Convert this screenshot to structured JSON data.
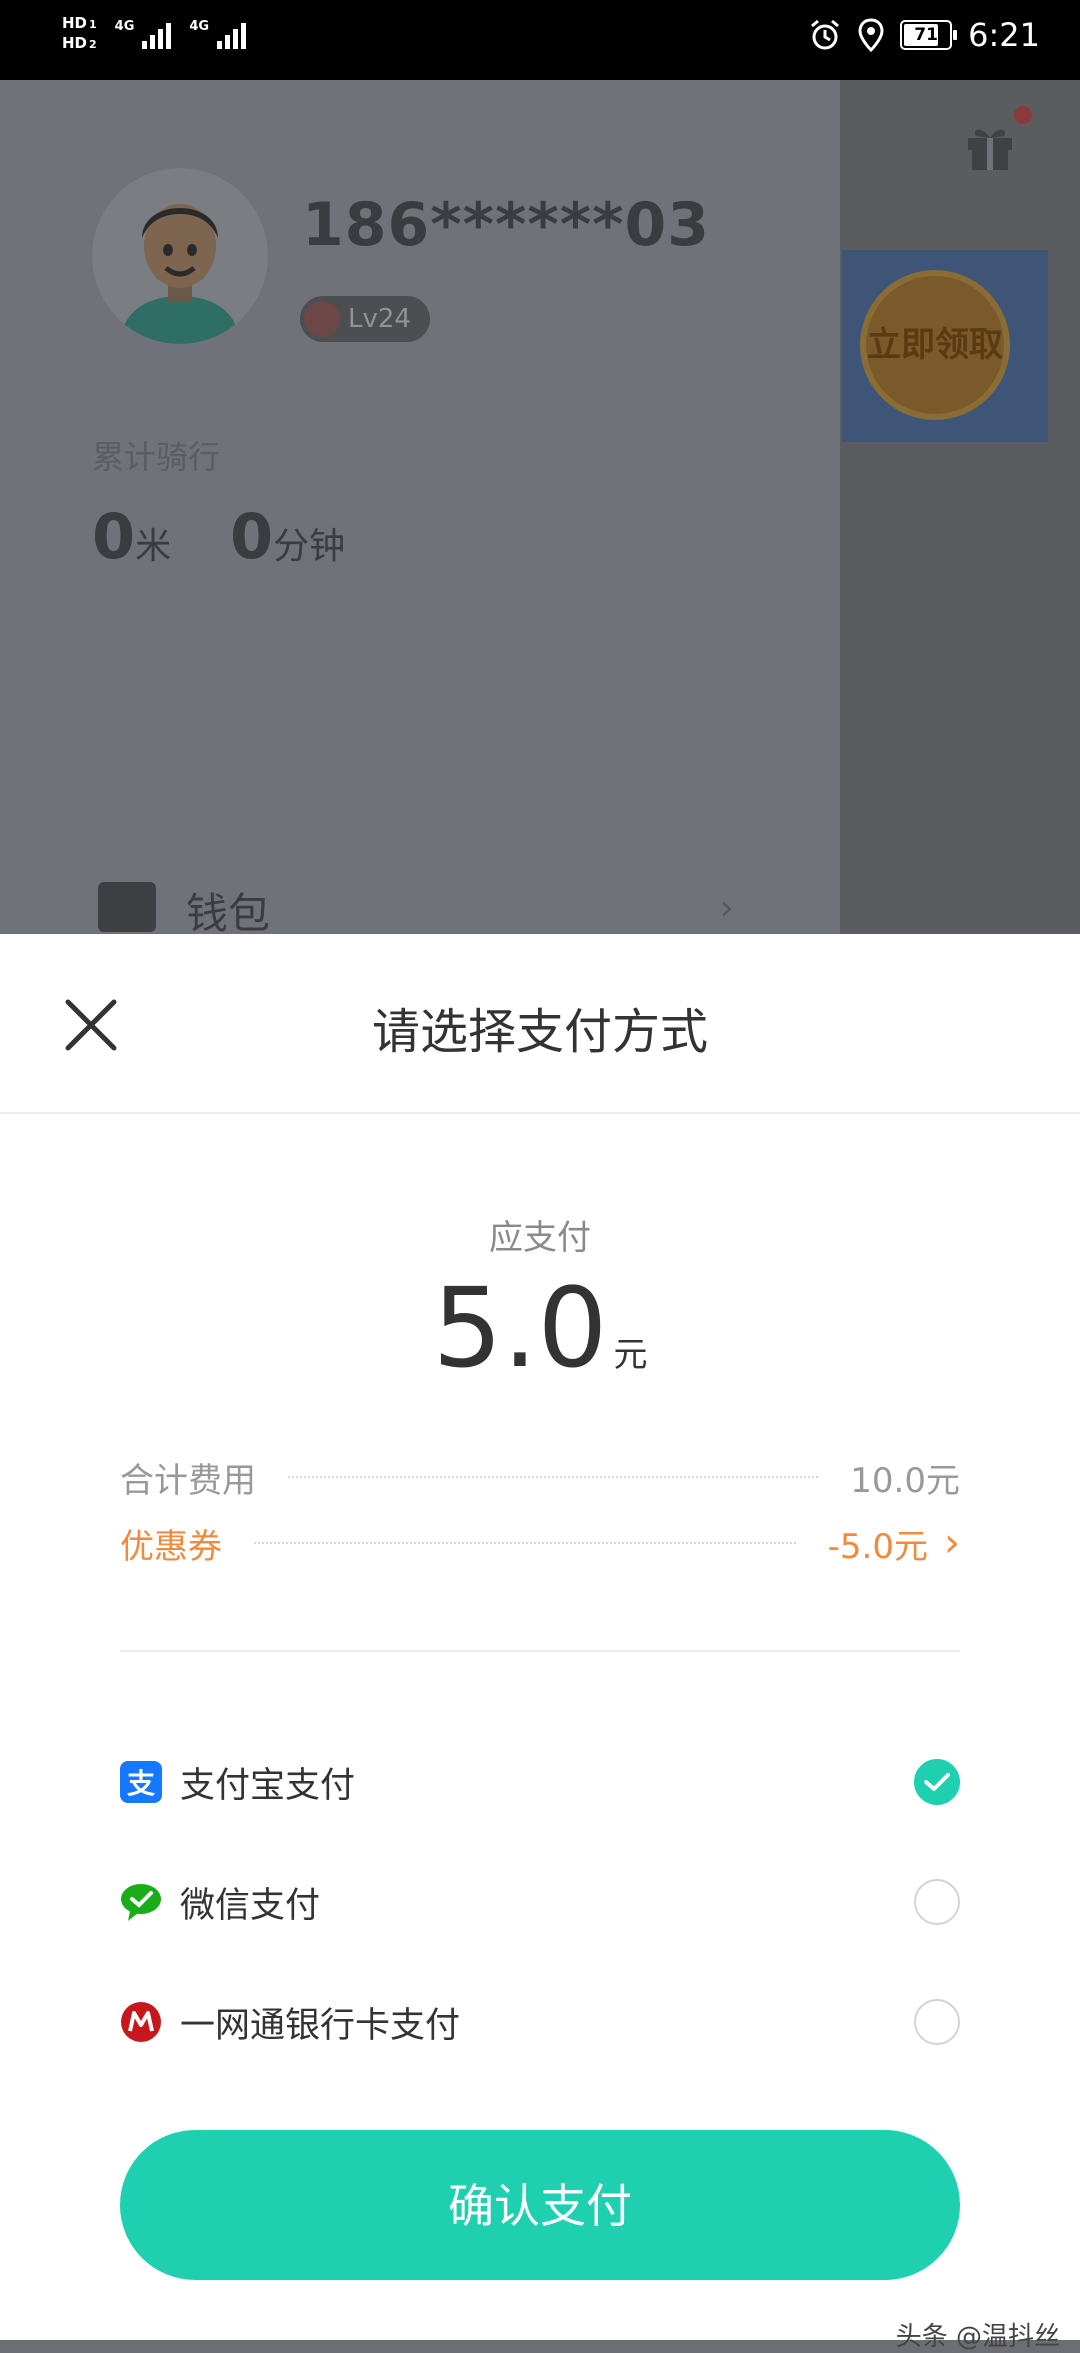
{
  "status_bar": {
    "hd1": "HD",
    "hd1_sub": "1",
    "hd2": "HD",
    "hd2_sub": "2",
    "net1": "4G",
    "net2": "4G",
    "battery": "71",
    "time": "6:21"
  },
  "background": {
    "phone": "186******03",
    "level": "Lv24",
    "cumulative_label": "累计骑行",
    "distance_value": "0",
    "distance_unit": "米",
    "duration_value": "0",
    "duration_unit": "分钟",
    "wallet_label": "钱包",
    "promo_text": "立即领取"
  },
  "sheet": {
    "title": "请选择支付方式",
    "due_label": "应支付",
    "amount": "5.0",
    "amount_unit": "元",
    "total_label": "合计费用",
    "total_value": "10.0元",
    "coupon_label": "优惠券",
    "coupon_value": "-5.0元",
    "methods": [
      {
        "label": "支付宝支付",
        "icon": "alipay-icon",
        "selected": true
      },
      {
        "label": "微信支付",
        "icon": "wechat-icon",
        "selected": false
      },
      {
        "label": "一网通银行卡支付",
        "icon": "cmb-icon",
        "selected": false
      }
    ],
    "confirm_label": "确认支付"
  },
  "watermark": "头条 @温抖丝",
  "colors": {
    "accent": "#1ecfb0",
    "coupon": "#f08a3c"
  }
}
